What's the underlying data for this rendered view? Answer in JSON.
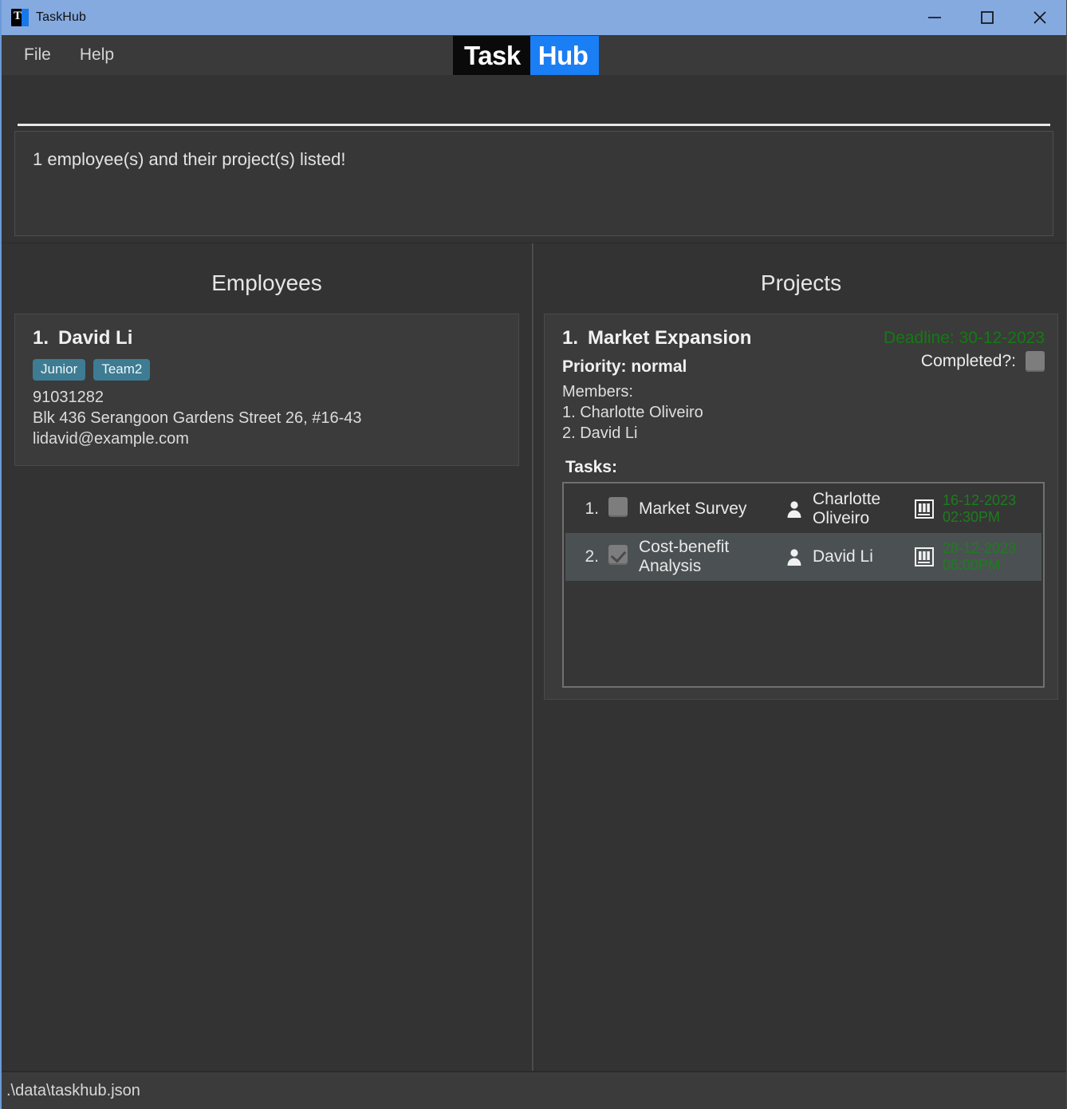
{
  "window": {
    "title": "TaskHub",
    "icon": "app-logo-icon",
    "controls": {
      "minimize": "minimize-icon",
      "maximize": "maximize-icon",
      "close": "close-icon"
    }
  },
  "menubar": {
    "items": [
      {
        "label": "File"
      },
      {
        "label": "Help"
      }
    ]
  },
  "logo": {
    "part1": "Task",
    "part2": "Hub",
    "part1_bg": "#0a0a0a",
    "part2_bg": "#1a7ef5"
  },
  "message": {
    "text": "1 employee(s) and their project(s) listed!"
  },
  "employees_panel": {
    "title": "Employees",
    "employees": [
      {
        "index": "1.",
        "name": "David Li",
        "tags": [
          "Junior",
          "Team2"
        ],
        "phone": "91031282",
        "address": "Blk 436 Serangoon Gardens Street 26, #16-43",
        "email": "lidavid@example.com"
      }
    ]
  },
  "projects_panel": {
    "title": "Projects",
    "projects": [
      {
        "index": "1.",
        "name": "Market Expansion",
        "priority": "Priority: normal",
        "deadline": "Deadline: 30-12-2023",
        "completed_label": "Completed?:",
        "completed": false,
        "members_label": "Members:",
        "members": [
          "1. Charlotte Oliveiro",
          "2. David Li"
        ],
        "tasks_label": "Tasks:",
        "tasks": [
          {
            "index": "1.",
            "done": false,
            "title": "Market Survey",
            "assignee": "Charlotte Oliveiro",
            "date": "16-12-2023",
            "time": "02:30PM",
            "person_icon": "person-icon",
            "calendar_icon": "calendar-icon"
          },
          {
            "index": "2.",
            "done": true,
            "title": "Cost-benefit Analysis",
            "assignee": "David Li",
            "date": "28-12-2023",
            "time": "06:00PM",
            "person_icon": "person-icon",
            "calendar_icon": "calendar-icon"
          }
        ]
      }
    ]
  },
  "statusbar": {
    "path": ".\\data\\taskhub.json"
  },
  "colors": {
    "titlebar": "#85aae0",
    "background": "#333333",
    "card": "#3b3b3b",
    "accent_green": "#137a13",
    "tag": "#3d7c92",
    "logo_blue": "#1a7ef5"
  }
}
